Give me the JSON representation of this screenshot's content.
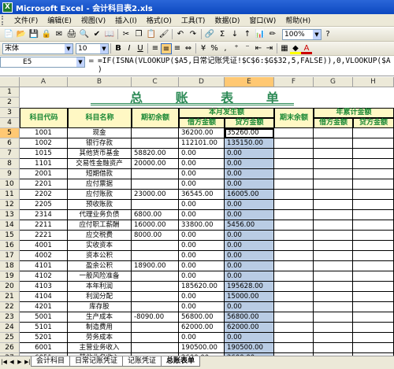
{
  "window": {
    "title": "Microsoft Excel - 会计科目表2.xls",
    "app_icon": "excel-icon"
  },
  "menu": [
    "文件(F)",
    "编辑(E)",
    "视图(V)",
    "插入(I)",
    "格式(O)",
    "工具(T)",
    "数据(D)",
    "窗口(W)",
    "帮助(H)"
  ],
  "toolbar": {
    "zoom": "100%"
  },
  "format": {
    "font": "宋体",
    "size": "10",
    "bold": "B",
    "italic": "I",
    "underline": "U"
  },
  "namebox": "E5",
  "formula": "=IF(ISNA(VLOOKUP($A5,日常记账凭证!$C$6:$G$32,5,FALSE)),0,VLOOKUP($A\n)",
  "columns": [
    "A",
    "B",
    "C",
    "D",
    "E",
    "F",
    "G",
    "H"
  ],
  "sheet": {
    "title": "总 账 表 单",
    "headers": {
      "code": "科目代码",
      "name": "科目名称",
      "opening": "期初余额",
      "month": "本月发生额",
      "debit": "借方金额",
      "credit": "贷方金额",
      "closing": "期末余额",
      "ytd": "年累计金额",
      "ytd_debit": "借方金额",
      "ytd_credit": "贷方金额"
    },
    "rows": [
      {
        "n": "5",
        "code": "1001",
        "name": "现金",
        "open": "",
        "d": "36200.00",
        "cr": "35260.00"
      },
      {
        "n": "6",
        "code": "1002",
        "name": "银行存款",
        "open": "",
        "d": "112101.00",
        "cr": "135150.00"
      },
      {
        "n": "7",
        "code": "1015",
        "name": "其他货币基金",
        "open": "58820.00",
        "d": "0.00",
        "cr": "0.00"
      },
      {
        "n": "8",
        "code": "1101",
        "name": "交易性金融资产",
        "open": "20000.00",
        "d": "0.00",
        "cr": "0.00"
      },
      {
        "n": "9",
        "code": "2001",
        "name": "短期借款",
        "open": "",
        "d": "0.00",
        "cr": "0.00"
      },
      {
        "n": "10",
        "code": "2201",
        "name": "应付票据",
        "open": "",
        "d": "0.00",
        "cr": "0.00"
      },
      {
        "n": "11",
        "code": "2202",
        "name": "应付账款",
        "open": "23000.00",
        "d": "36545.00",
        "cr": "16005.00"
      },
      {
        "n": "12",
        "code": "2205",
        "name": "预收账款",
        "open": "",
        "d": "0.00",
        "cr": "0.00"
      },
      {
        "n": "13",
        "code": "2314",
        "name": "代理业务负债",
        "open": "6800.00",
        "d": "0.00",
        "cr": "0.00"
      },
      {
        "n": "14",
        "code": "2211",
        "name": "应付职工薪酬",
        "open": "16000.00",
        "d": "33800.00",
        "cr": "5456.00"
      },
      {
        "n": "15",
        "code": "2221",
        "name": "应交税费",
        "open": "8000.00",
        "d": "0.00",
        "cr": "0.00"
      },
      {
        "n": "16",
        "code": "4001",
        "name": "实收资本",
        "open": "",
        "d": "0.00",
        "cr": "0.00"
      },
      {
        "n": "17",
        "code": "4002",
        "name": "资本公积",
        "open": "",
        "d": "0.00",
        "cr": "0.00"
      },
      {
        "n": "18",
        "code": "4101",
        "name": "盈余公积",
        "open": "18900.00",
        "d": "0.00",
        "cr": "0.00"
      },
      {
        "n": "19",
        "code": "4102",
        "name": "一般风险准备",
        "open": "",
        "d": "0.00",
        "cr": "0.00"
      },
      {
        "n": "20",
        "code": "4103",
        "name": "本年利润",
        "open": "",
        "d": "185620.00",
        "cr": "195628.00"
      },
      {
        "n": "21",
        "code": "4104",
        "name": "利润分配",
        "open": "",
        "d": "0.00",
        "cr": "15000.00"
      },
      {
        "n": "22",
        "code": "4201",
        "name": "库存股",
        "open": "",
        "d": "0.00",
        "cr": "0.00"
      },
      {
        "n": "23",
        "code": "5001",
        "name": "生产成本",
        "open": "-8090.00",
        "d": "56800.00",
        "cr": "56800.00"
      },
      {
        "n": "24",
        "code": "5101",
        "name": "制造费用",
        "open": "",
        "d": "62000.00",
        "cr": "62000.00"
      },
      {
        "n": "25",
        "code": "5201",
        "name": "劳务成本",
        "open": "",
        "d": "0.00",
        "cr": "0.00"
      },
      {
        "n": "26",
        "code": "6001",
        "name": "主营业务收入",
        "open": "",
        "d": "190500.00",
        "cr": "190500.00"
      },
      {
        "n": "27",
        "code": "6051",
        "name": "其他业务收入",
        "open": "",
        "d": "2600.00",
        "cr": "2600.00"
      }
    ]
  },
  "tabs": [
    "会计科目",
    "日常记账凭证",
    "记账凭证",
    "总账表单"
  ]
}
